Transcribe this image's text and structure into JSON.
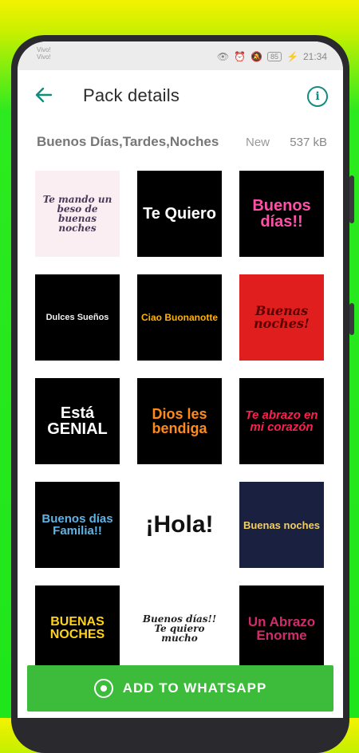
{
  "statusbar": {
    "carrier_top": "Vivo!",
    "carrier_bottom": "Vivo!",
    "battery": "85",
    "time": "21:34"
  },
  "appbar": {
    "title": "Pack details",
    "back_icon": "arrow-left-icon",
    "info_icon": "info-circle-icon"
  },
  "pack": {
    "name": "Buenos Días,Tardes,Noches",
    "badge": "New",
    "size": "537 kB"
  },
  "stickers": [
    {
      "text": "Te mando un beso de buenas noches",
      "bg": "#fbeef2",
      "color": "#4a3a5a"
    },
    {
      "text": "Te Quiero",
      "bg": "#000000",
      "color": "#ffffff"
    },
    {
      "text": "Buenos días!!",
      "bg": "#000000",
      "color": "#ff4fa8"
    },
    {
      "text": "Dulces Sueños",
      "bg": "#000000",
      "color": "#f0f0f0"
    },
    {
      "text": "Ciao Buonanotte",
      "bg": "#000000",
      "color": "#ffb300"
    },
    {
      "text": "Buenas noches!",
      "bg": "#e01e1e",
      "color": "#5a0000"
    },
    {
      "text": "Está GENIAL",
      "bg": "#000000",
      "color": "#ffffff"
    },
    {
      "text": "Dios les bendiga",
      "bg": "#000000",
      "color": "#ff8a1a"
    },
    {
      "text": "Te abrazo en mi corazón",
      "bg": "#000000",
      "color": "#ff1f4f"
    },
    {
      "text": "Buenos días Familia!!",
      "bg": "#000000",
      "color": "#5fb3e6"
    },
    {
      "text": "¡Hola!",
      "bg": "#ffffff",
      "color": "#111111"
    },
    {
      "text": "Buenas noches",
      "bg": "#1a2040",
      "color": "#f0d060"
    },
    {
      "text": "BUENAS NOCHES",
      "bg": "#000000",
      "color": "#ffd21a"
    },
    {
      "text": "Buenos días!! Te quiero mucho",
      "bg": "#ffffff",
      "color": "#222222"
    },
    {
      "text": "Un Abrazo Enorme",
      "bg": "#000000",
      "color": "#d22b6a"
    }
  ],
  "add_button": {
    "label": "ADD TO WHATSAPP",
    "icon": "whatsapp-icon"
  }
}
